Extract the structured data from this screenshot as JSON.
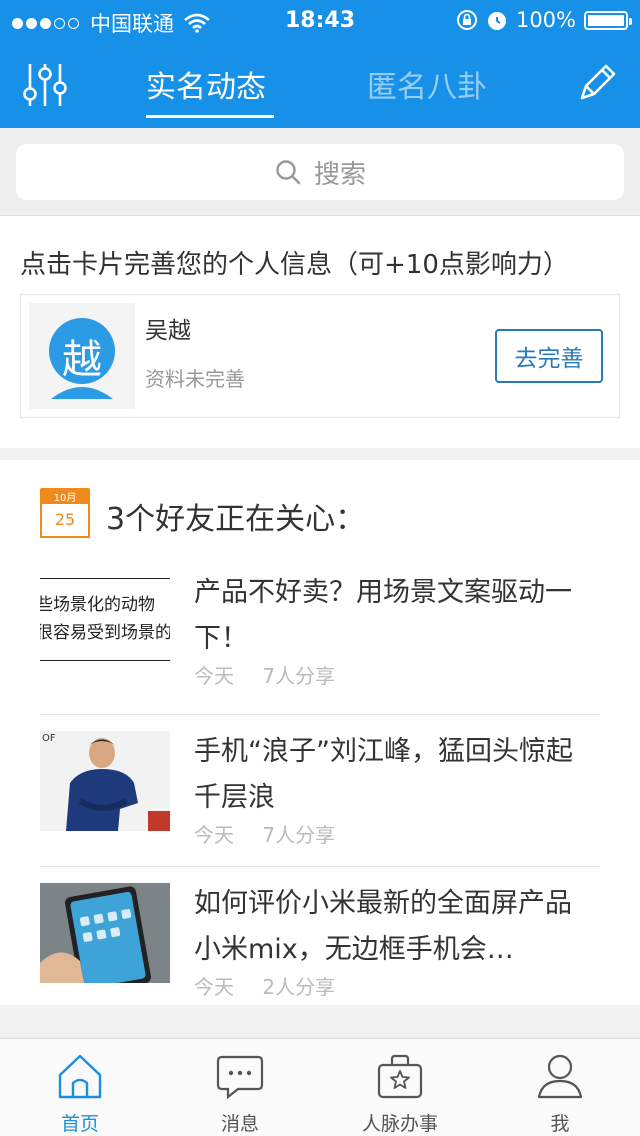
{
  "status_bar": {
    "carrier": "中国联通",
    "time": "18:43",
    "battery": "100%"
  },
  "header": {
    "tabs": [
      {
        "label": "实名动态",
        "active": true
      },
      {
        "label": "匿名八卦",
        "active": false
      }
    ],
    "filter_icon": "sliders-icon",
    "edit_icon": "pencil-icon"
  },
  "search": {
    "placeholder": "搜索"
  },
  "profile_prompt": {
    "text": "点击卡片完善您的个人信息（可+10点影响力）",
    "card": {
      "avatar_char": "越",
      "name": "吴越",
      "status": "资料未完善",
      "button": "去完善"
    }
  },
  "friends": {
    "calendar": {
      "month": "10月",
      "day": "25"
    },
    "title": "3个好友正在关心：",
    "articles": [
      {
        "thumb_lines": [
          "些场景化的动物",
          "很容易受到场景的"
        ],
        "title": "产品不好卖？用场景文案驱动一下！",
        "date": "今天",
        "shares": "7人分享"
      },
      {
        "thumb_lines": [
          "OF"
        ],
        "title": "手机“浪子”刘江峰，猛回头惊起千层浪",
        "date": "今天",
        "shares": "7人分享"
      },
      {
        "thumb_lines": [],
        "title": "如何评价小米最新的全面屏产品小米mix，无边框手机会…",
        "date": "今天",
        "shares": "2人分享"
      }
    ]
  },
  "tabbar": {
    "items": [
      {
        "label": "首页",
        "icon": "home-icon",
        "active": true
      },
      {
        "label": "消息",
        "icon": "chat-bubble-icon",
        "active": false
      },
      {
        "label": "人脉办事",
        "icon": "briefcase-star-icon",
        "active": false
      },
      {
        "label": "我",
        "icon": "person-icon",
        "active": false
      }
    ]
  },
  "colors": {
    "header_blue": "#1790e8",
    "button_blue": "#2a7ab8",
    "calendar_orange": "#f08a1c",
    "tab_active": "#1a8fe0"
  }
}
